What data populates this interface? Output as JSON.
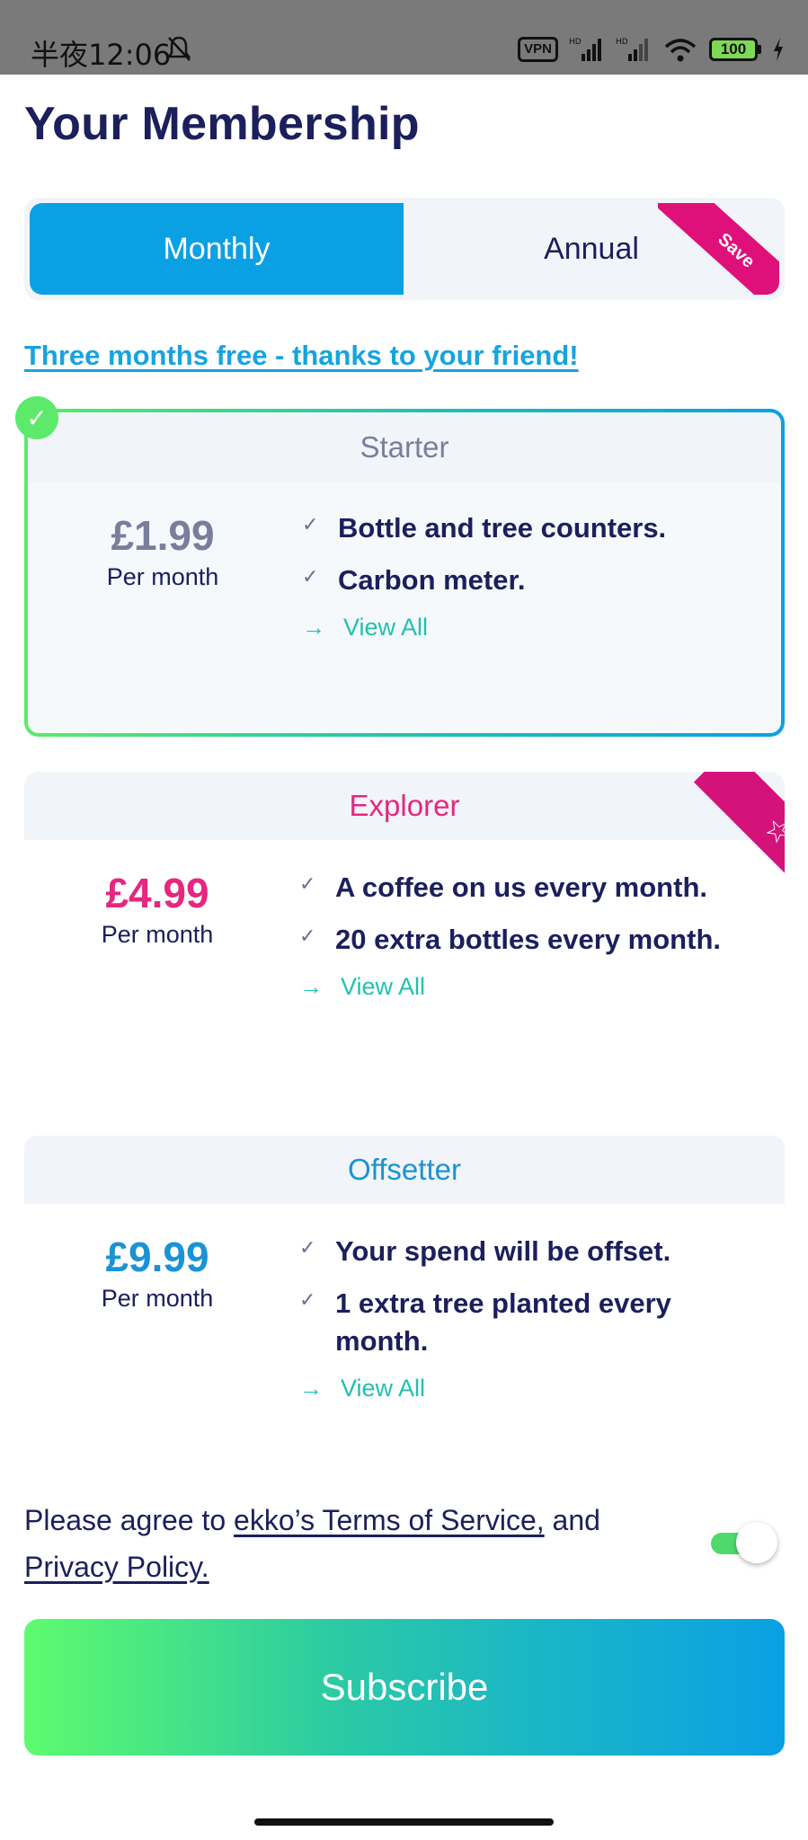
{
  "status_bar": {
    "time": "半夜12:06",
    "vpn": "VPN",
    "battery": "100",
    "icons": [
      "mute-bell-icon",
      "signal-icon",
      "signal-icon",
      "wifi-icon",
      "battery-icon",
      "charging-icon"
    ]
  },
  "page_title": "Your Membership",
  "billing": {
    "monthly_label": "Monthly",
    "annual_label": "Annual",
    "save_badge": "Save",
    "selected": "Monthly"
  },
  "promo_link": "Three months free - thanks to your friend!",
  "plans": [
    {
      "name": "Starter",
      "price": "£1.99",
      "period": "Per month",
      "features": [
        "Bottle and tree counters.",
        "Carbon meter."
      ],
      "view_all": "View All",
      "selected": true,
      "accent": "#7a7e9c"
    },
    {
      "name": "Explorer",
      "price": "£4.99",
      "period": "Per month",
      "features": [
        "A  coffee on us every month.",
        "20 extra bottles every month."
      ],
      "view_all": "View All",
      "badge_icon": "star-icon",
      "accent": "#e6267f"
    },
    {
      "name": "Offsetter",
      "price": "£9.99",
      "period": "Per month",
      "features": [
        "Your spend will be offset.",
        "1 extra tree planted every month."
      ],
      "view_all": "View All",
      "accent": "#1a93d6"
    }
  ],
  "terms": {
    "prefix": "Please agree to ",
    "tos_link": "ekko’s Terms of Service,",
    "middle": " and",
    "privacy_link": "Privacy Policy.",
    "agreed": true
  },
  "subscribe_label": "Subscribe",
  "colors": {
    "primary_blue": "#0aa0e4",
    "green": "#5dea6a",
    "pink": "#e0107a",
    "navy": "#1b1f5c",
    "teal": "#22c0b0"
  }
}
